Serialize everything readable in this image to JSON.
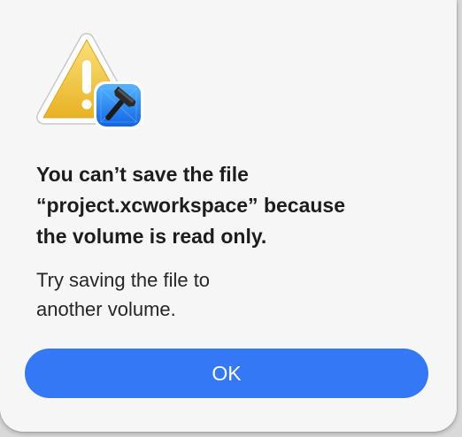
{
  "alert": {
    "title_lines": [
      "You can’t save the file",
      "“project.xcworkspace” because",
      "the volume is read only."
    ],
    "message_lines": [
      "Try saving the file to",
      "another volume."
    ],
    "ok_label": "OK",
    "icon": "caution-triangle-with-xcode-badge-icon"
  },
  "colors": {
    "accent": "#3478f6",
    "background": "#f6f6f6",
    "warning_yellow": "#f2c12e",
    "xcode_blue": "#1d8cf2"
  }
}
